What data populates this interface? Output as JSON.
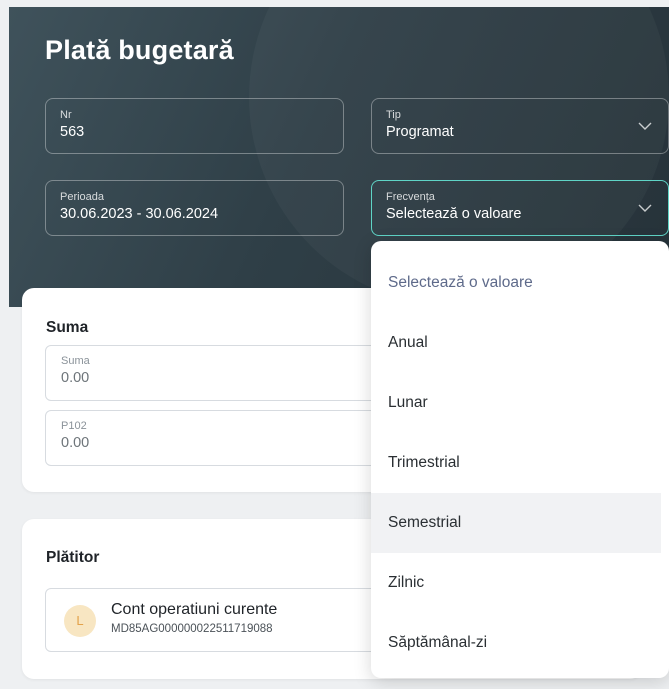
{
  "header": {
    "title": "Plată bugetară",
    "nr": {
      "label": "Nr",
      "value": "563"
    },
    "tip": {
      "label": "Tip",
      "value": "Programat"
    },
    "perioada": {
      "label": "Perioada",
      "value": "30.06.2023 - 30.06.2024"
    },
    "frecventa": {
      "label": "Frecvența",
      "value": "Selectează o valoare"
    }
  },
  "suma_section": {
    "title": "Suma",
    "suma": {
      "label": "Suma",
      "value": "0.00"
    },
    "p102": {
      "label": "P102",
      "value": "0.00"
    }
  },
  "platitor_section": {
    "title": "Plătitor",
    "account": {
      "avatar_letter": "L",
      "name": "Cont operatiuni curente",
      "iban": "MD85AG000000022511719088"
    }
  },
  "dropdown": {
    "options": [
      "Selectează o valoare",
      "Anual",
      "Lunar",
      "Trimestrial",
      "Semestrial",
      "Zilnic",
      "Săptămânal-zi"
    ],
    "hovered_option": "Semestrial"
  },
  "colors": {
    "header_bg": "#2f3f47",
    "active_border": "#5fd4c6",
    "avatar_bg": "#f8e6c2",
    "avatar_text": "#e3a24a",
    "placeholder_option": "#5e6a8a"
  },
  "icons": {
    "select_chevron": "chevron-down-icon"
  }
}
